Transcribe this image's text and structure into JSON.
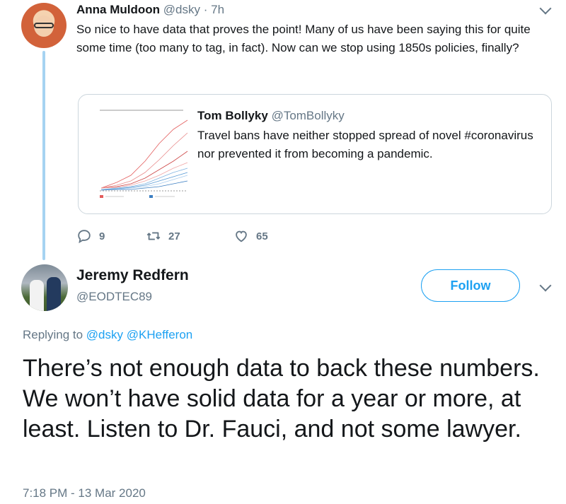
{
  "tweet1": {
    "name": "Anna Muldoon",
    "handle": "@dsky",
    "separator": "·",
    "time": "7h",
    "text": "So nice to have data that proves the point!  Many of us have been saying this for quite some time (too many to tag, in fact).  Now can we stop using 1850s policies, finally?",
    "quote": {
      "name": "Tom Bollyky",
      "handle": "@TomBollyky",
      "text": "Travel bans have neither stopped spread of novel #coronavirus nor prevented it from becoming a pandemic."
    },
    "actions": {
      "reply_count": "9",
      "retweet_count": "27",
      "like_count": "65"
    }
  },
  "tweet2": {
    "name": "Jeremy Redfern",
    "handle": "@EODTEC89",
    "follow_label": "Follow",
    "replying_prefix": "Replying to",
    "replying_to_1": "@dsky",
    "replying_to_2": "@KHefferon",
    "text": "There’s not enough data to back these numbers. We won’t have solid data for a year or more, at least. Listen to Dr. Fauci, and not some lawyer.",
    "timestamp": "7:18 PM - 13 Mar 2020"
  },
  "colors": {
    "accent": "#1da1f2",
    "muted": "#657786",
    "thread_line": "#a6d3f2",
    "border": "#ccd6dd"
  },
  "icons": [
    "chevron-down-icon",
    "reply-icon",
    "retweet-icon",
    "like-icon"
  ]
}
